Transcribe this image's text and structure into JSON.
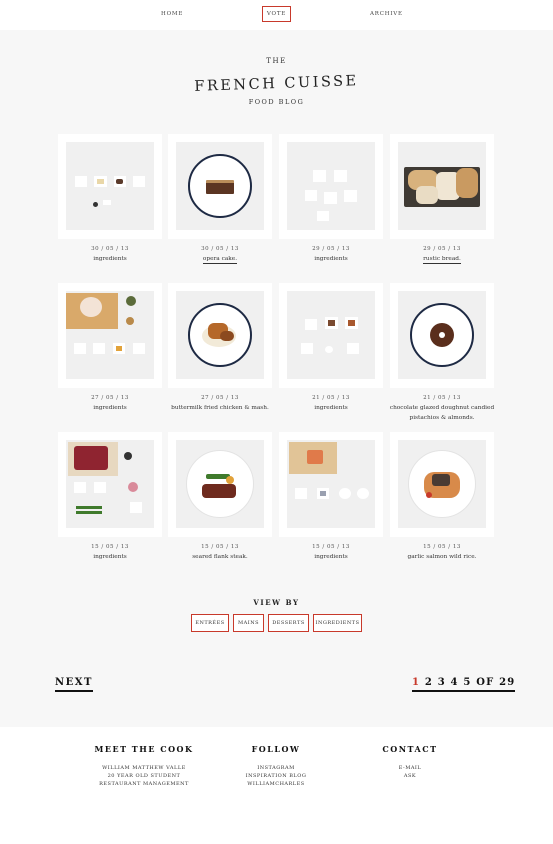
{
  "nav": {
    "home": "HOME",
    "vote": "VOTE",
    "archive": "ARCHIVE"
  },
  "header": {
    "the": "THE",
    "title": "FRENCH CUISSE",
    "subtitle": "FOOD BLOG"
  },
  "posts": [
    {
      "date": "30 / 05 / 13",
      "caption": "ingredients"
    },
    {
      "date": "30 / 05 / 13",
      "caption": "opera cake."
    },
    {
      "date": "29 / 05 / 13",
      "caption": "ingredients"
    },
    {
      "date": "29 / 05 / 13",
      "caption": "rustic bread."
    },
    {
      "date": "27 / 05 / 13",
      "caption": "ingredients"
    },
    {
      "date": "27 / 05 / 13",
      "caption": "buttermilk fried chicken & mash."
    },
    {
      "date": "21 / 05 / 13",
      "caption": "ingredients"
    },
    {
      "date": "21 / 05 / 13",
      "caption": "chocolate glazed doughnut candied pistachios & almonds."
    },
    {
      "date": "15 / 05 / 13",
      "caption": "ingredients"
    },
    {
      "date": "15 / 05 / 13",
      "caption": "seared flank steak."
    },
    {
      "date": "15 / 05 / 13",
      "caption": "ingredients"
    },
    {
      "date": "15 / 05 / 13",
      "caption": "garlic salmon wild rice."
    }
  ],
  "viewby": {
    "title": "VIEW BY",
    "buttons": [
      "ENTRÉES",
      "MAINS",
      "DESSERTS",
      "INGREDIENTS"
    ]
  },
  "pagination": {
    "next": "NEXT",
    "current": "1",
    "pages": "2 3 4 5 OF 29"
  },
  "footer": {
    "meet": {
      "title": "MEET THE COOK",
      "lines": [
        "WILLIAM MATTHEW VALLE",
        "20 YEAR OLD STUDENT",
        "RESTAURANT MANAGEMENT"
      ]
    },
    "follow": {
      "title": "FOLLOW",
      "lines": [
        "INSTAGRAM",
        "INSPIRATION BLOG",
        "WILLIAMCHARLES"
      ]
    },
    "contact": {
      "title": "CONTACT",
      "lines": [
        "E-MAIL",
        "ASK"
      ]
    }
  },
  "colors": {
    "accent": "#c8392b",
    "background": "#f7f7f7",
    "card": "#ffffff"
  }
}
